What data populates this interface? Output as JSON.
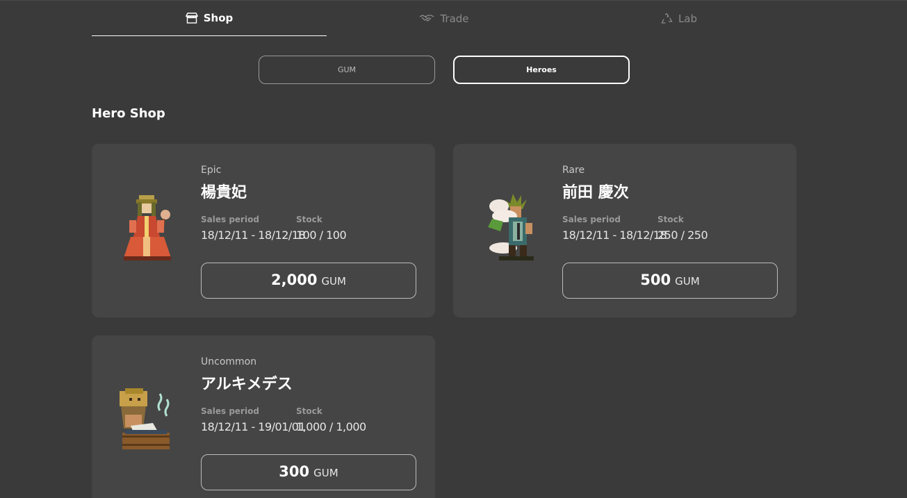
{
  "nav": {
    "tabs": [
      {
        "label": "Shop",
        "icon": "store-icon",
        "active": true
      },
      {
        "label": "Trade",
        "icon": "handshake-icon",
        "active": false
      },
      {
        "label": "Lab",
        "icon": "recycle-icon",
        "active": false
      }
    ]
  },
  "subtabs": [
    {
      "label": "GUM",
      "active": false
    },
    {
      "label": "Heroes",
      "active": true
    }
  ],
  "section": {
    "title": "Hero Shop"
  },
  "labels": {
    "sales_period": "Sales period",
    "stock": "Stock"
  },
  "heroes": [
    {
      "rarity": "Epic",
      "name": "楊貴妃",
      "sales_period": "18/12/11 - 18/12/18",
      "stock": "100 / 100",
      "price": "2,000",
      "currency": "GUM"
    },
    {
      "rarity": "Rare",
      "name": "前田 慶次",
      "sales_period": "18/12/11 - 18/12/18",
      "stock": "250 / 250",
      "price": "500",
      "currency": "GUM"
    },
    {
      "rarity": "Uncommon",
      "name": "アルキメデス",
      "sales_period": "18/12/11 - 19/01/01",
      "stock": "1,000 / 1,000",
      "price": "300",
      "currency": "GUM"
    }
  ],
  "colors": {
    "background": "#3a3a3a",
    "card": "#454545",
    "accent": "#ffffff",
    "muted": "#8a8a8a"
  }
}
